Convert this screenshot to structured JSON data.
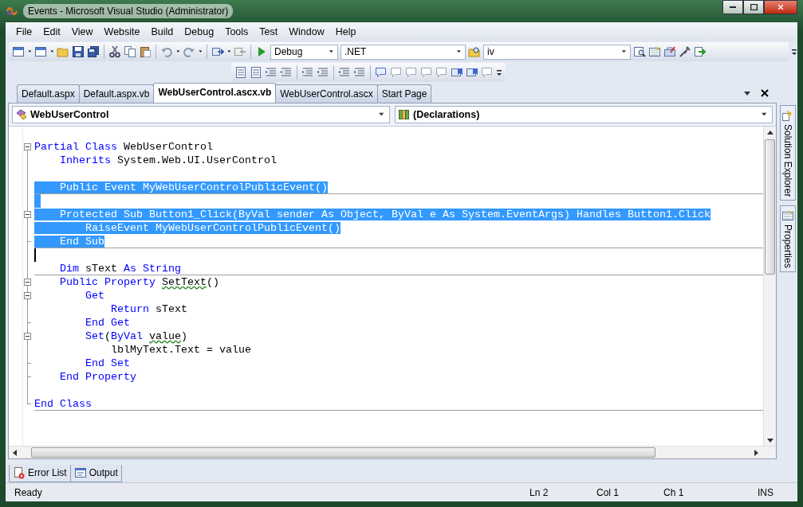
{
  "window": {
    "title": "Events - Microsoft Visual Studio (Administrator)"
  },
  "menu": [
    {
      "label": "File"
    },
    {
      "label": "Edit"
    },
    {
      "label": "View"
    },
    {
      "label": "Website"
    },
    {
      "label": "Build"
    },
    {
      "label": "Debug"
    },
    {
      "label": "Tools"
    },
    {
      "label": "Test"
    },
    {
      "label": "Window"
    },
    {
      "label": "Help"
    }
  ],
  "toolbar": {
    "configuration": "Debug",
    "platform": ".NET",
    "find": "iv"
  },
  "document_tabs": [
    {
      "label": "Default.aspx",
      "selected": false
    },
    {
      "label": "Default.aspx.vb",
      "selected": false
    },
    {
      "label": "WebUserControl.ascx.vb",
      "selected": true
    },
    {
      "label": "WebUserControl.ascx",
      "selected": false
    },
    {
      "label": "Start Page",
      "selected": false
    }
  ],
  "navigation": {
    "class_list": "WebUserControl",
    "member_list": "(Declarations)"
  },
  "code_lines": [
    {
      "collapsible": true,
      "block_end": false,
      "selected": false,
      "separator": false,
      "tokens": [
        {
          "text": "Partial Class",
          "kind": "keyword"
        },
        {
          "text": " WebUserControl",
          "kind": "plain"
        }
      ]
    },
    {
      "collapsible": false,
      "block_end": false,
      "selected": false,
      "separator": false,
      "tokens": [
        {
          "text": "    Inherits",
          "kind": "keyword"
        },
        {
          "text": " System.Web.UI.UserControl",
          "kind": "plain"
        }
      ]
    },
    {
      "collapsible": false,
      "block_end": false,
      "selected": false,
      "separator": false
    },
    {
      "collapsible": false,
      "block_end": false,
      "selected": true,
      "separator": true,
      "tokens": [
        {
          "text": "    Public Event",
          "kind": "keyword"
        },
        {
          "text": " MyWebUserControlPublicEvent()",
          "kind": "plain"
        }
      ]
    },
    {
      "collapsible": false,
      "block_end": false,
      "selected": true,
      "separator": false
    },
    {
      "collapsible": true,
      "block_end": false,
      "selected": true,
      "separator": false,
      "tokens": [
        {
          "text": "    Protected Sub",
          "kind": "keyword"
        },
        {
          "text": " Button1_Click(",
          "kind": "plain"
        },
        {
          "text": "ByVal",
          "kind": "keyword"
        },
        {
          "text": " sender ",
          "kind": "plain"
        },
        {
          "text": "As Object",
          "kind": "keyword"
        },
        {
          "text": ", ",
          "kind": "plain"
        },
        {
          "text": "ByVal",
          "kind": "keyword"
        },
        {
          "text": " e ",
          "kind": "plain"
        },
        {
          "text": "As",
          "kind": "keyword"
        },
        {
          "text": " System.EventArgs) ",
          "kind": "plain"
        },
        {
          "text": "Handles",
          "kind": "keyword"
        },
        {
          "text": " Button1.Click",
          "kind": "plain"
        }
      ]
    },
    {
      "collapsible": false,
      "block_end": false,
      "selected": true,
      "separator": false,
      "tokens": [
        {
          "text": "        RaiseEvent",
          "kind": "keyword"
        },
        {
          "text": " MyWebUserControlPublicEvent()",
          "kind": "plain"
        }
      ]
    },
    {
      "collapsible": false,
      "block_end": true,
      "selected": true,
      "separator": true,
      "tokens": [
        {
          "text": "    End Sub",
          "kind": "keyword"
        }
      ]
    },
    {
      "collapsible": false,
      "block_end": false,
      "selected": false,
      "separator": false,
      "cursor": true
    },
    {
      "collapsible": false,
      "block_end": false,
      "selected": false,
      "separator": true,
      "tokens": [
        {
          "text": "    Dim",
          "kind": "keyword"
        },
        {
          "text": " sText ",
          "kind": "plain"
        },
        {
          "text": "As String",
          "kind": "keyword"
        }
      ]
    },
    {
      "collapsible": true,
      "block_end": false,
      "selected": false,
      "separator": false,
      "tokens": [
        {
          "text": "    Public Property ",
          "kind": "keyword"
        },
        {
          "text": "SetText",
          "kind": "squiggle"
        },
        {
          "text": "()",
          "kind": "plain"
        }
      ]
    },
    {
      "collapsible": true,
      "block_end": false,
      "selected": false,
      "separator": false,
      "tokens": [
        {
          "text": "        Get",
          "kind": "keyword"
        }
      ]
    },
    {
      "collapsible": false,
      "block_end": false,
      "selected": false,
      "separator": false,
      "tokens": [
        {
          "text": "            Return",
          "kind": "keyword"
        },
        {
          "text": " sText",
          "kind": "plain"
        }
      ]
    },
    {
      "collapsible": false,
      "block_end": true,
      "selected": false,
      "separator": false,
      "tokens": [
        {
          "text": "        End Get",
          "kind": "keyword"
        }
      ]
    },
    {
      "collapsible": true,
      "block_end": false,
      "selected": false,
      "separator": false,
      "tokens": [
        {
          "text": "        Set",
          "kind": "keyword"
        },
        {
          "text": "(",
          "kind": "plain"
        },
        {
          "text": "ByVal ",
          "kind": "keyword"
        },
        {
          "text": "value",
          "kind": "squiggle"
        },
        {
          "text": ")",
          "kind": "plain"
        }
      ]
    },
    {
      "collapsible": false,
      "block_end": false,
      "selected": false,
      "separator": false,
      "tokens": [
        {
          "text": "            lblMyText.Text = value",
          "kind": "plain"
        }
      ]
    },
    {
      "collapsible": false,
      "block_end": true,
      "selected": false,
      "separator": false,
      "tokens": [
        {
          "text": "        End Set",
          "kind": "keyword"
        }
      ]
    },
    {
      "collapsible": false,
      "block_end": true,
      "selected": false,
      "separator": false,
      "tokens": [
        {
          "text": "    End Property",
          "kind": "keyword"
        }
      ]
    },
    {
      "collapsible": false,
      "block_end": false,
      "selected": false,
      "separator": false
    },
    {
      "collapsible": false,
      "block_end": true,
      "selected": false,
      "separator": true,
      "tokens": [
        {
          "text": "End Class",
          "kind": "keyword"
        }
      ]
    }
  ],
  "side_tabs": [
    {
      "label": "Solution Explorer"
    },
    {
      "label": "Properties"
    }
  ],
  "bottom_tabs": [
    {
      "label": "Error List"
    },
    {
      "label": "Output"
    }
  ],
  "status_bar": {
    "message": "Ready",
    "line": "Ln 2",
    "column": "Col 1",
    "char": "Ch 1",
    "mode": "INS"
  }
}
